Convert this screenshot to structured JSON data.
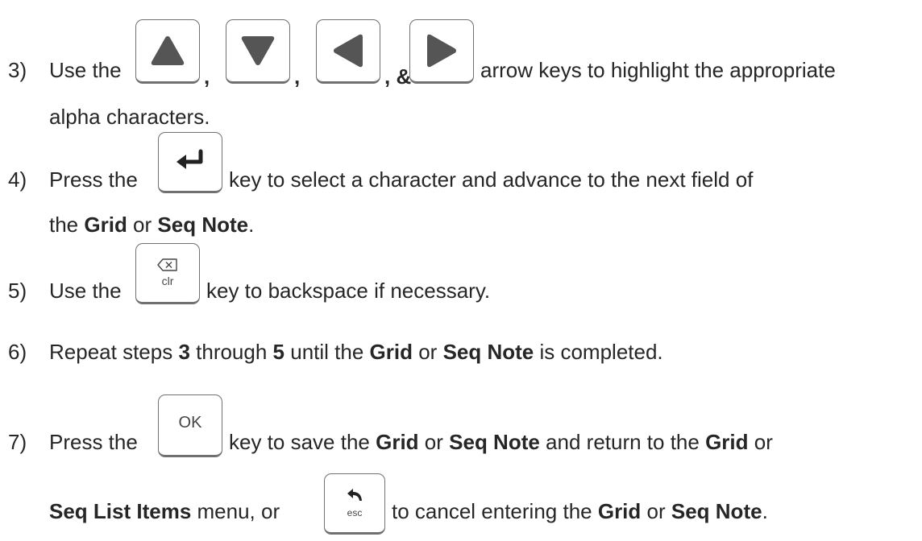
{
  "steps": [
    {
      "number": "3)",
      "line1_prefix": "Use the",
      "sep1": ",",
      "sep2": ",",
      "sep3": ", &",
      "line1_suffix": "arrow keys to highlight the appropriate",
      "line2": "alpha characters.",
      "keys": [
        "up-arrow-icon",
        "down-arrow-icon",
        "left-arrow-icon",
        "right-arrow-icon"
      ]
    },
    {
      "number": "4)",
      "line1_prefix": "Press the",
      "line1_suffix": "key to select a character and advance to the next field of",
      "line2_a": "the ",
      "line2_b": "Grid",
      "line2_c": " or ",
      "line2_d": "Seq Note",
      "line2_e": ".",
      "keys": [
        "enter-icon"
      ]
    },
    {
      "number": "5)",
      "line1_prefix": "Use the",
      "key_label": "clr",
      "line1_suffix": "key to backspace if necessary.",
      "keys": [
        "backspace-icon"
      ]
    },
    {
      "number": "6)",
      "t1": "Repeat steps ",
      "t2": "3",
      "t3": " through ",
      "t4": "5",
      "t5": " until the ",
      "t6": "Grid",
      "t7": " or ",
      "t8": "Seq Note",
      "t9": " is completed."
    },
    {
      "number": "7)",
      "line1_prefix": "Press the",
      "key_label": "OK",
      "l1a": "key to save the ",
      "l1b": "Grid",
      "l1c": " or ",
      "l1d": "Seq Note",
      "l1e": " and return to the ",
      "l1f": "Grid",
      "l1g": " or",
      "l2a": "Seq List Items",
      "l2b": " menu, or",
      "esc_label": "esc",
      "l2c": "to cancel entering the ",
      "l2d": "Grid",
      "l2e": " or ",
      "l2f": "Seq Note",
      "l2g": "."
    }
  ]
}
